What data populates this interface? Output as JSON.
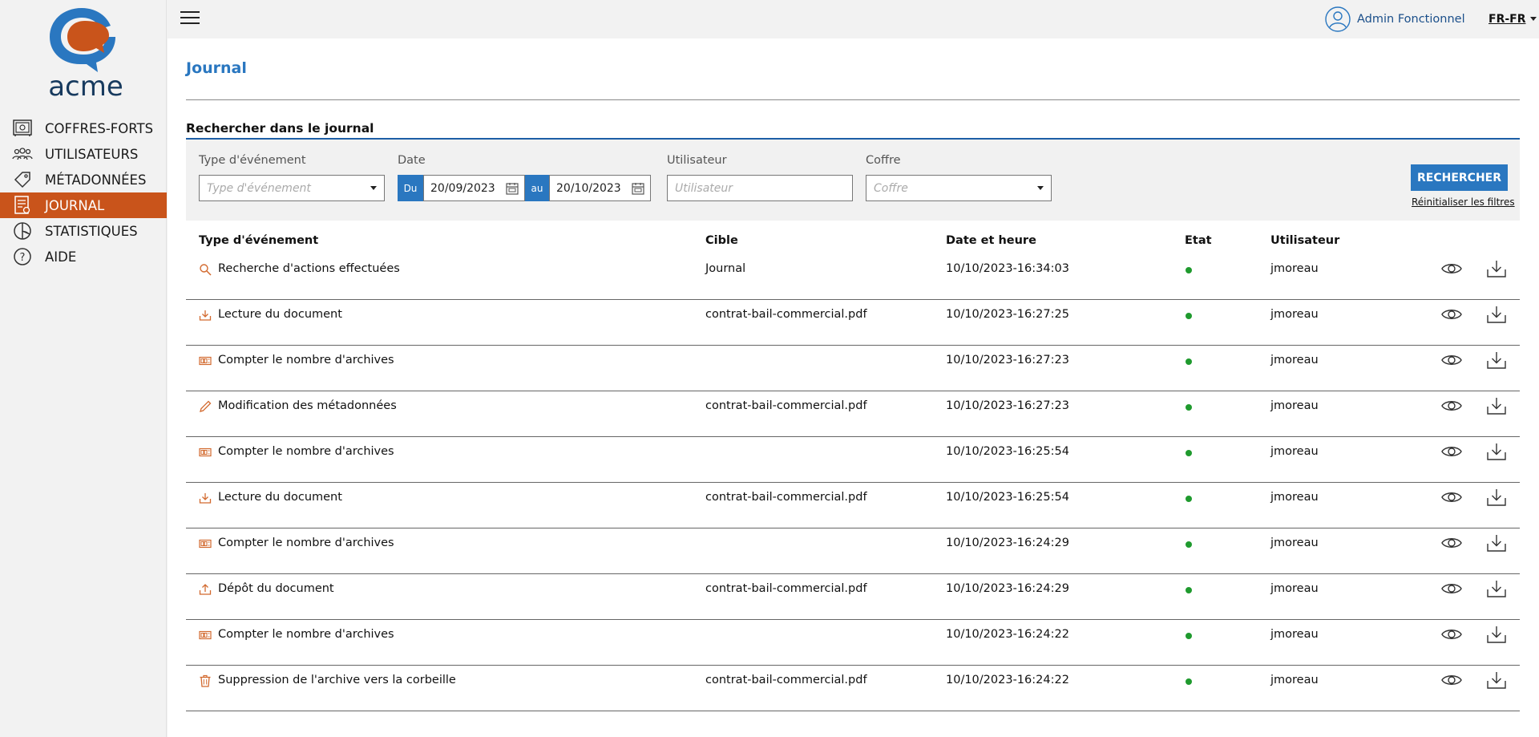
{
  "brand": {
    "logo_text": "acme",
    "accent": "#c9541b",
    "primary": "#2a77c0"
  },
  "sidebar": {
    "items": [
      {
        "label": "COFFRES-FORTS",
        "icon": "safe-icon"
      },
      {
        "label": "UTILISATEURS",
        "icon": "users-icon"
      },
      {
        "label": "MÉTADONNÉES",
        "icon": "tag-icon"
      },
      {
        "label": "JOURNAL",
        "icon": "journal-icon",
        "active": true
      },
      {
        "label": "STATISTIQUES",
        "icon": "pie-chart-icon"
      },
      {
        "label": "AIDE",
        "icon": "help-icon"
      }
    ]
  },
  "topbar": {
    "user_name": "Admin Fonctionnel",
    "language": "FR-FR"
  },
  "page": {
    "title": "Journal",
    "section_title": "Rechercher dans le journal"
  },
  "filters": {
    "event_type": {
      "label": "Type d'événement",
      "placeholder": "Type d'événement"
    },
    "date": {
      "label": "Date",
      "from_tag": "Du",
      "from_value": "20/09/2023",
      "to_tag": "au",
      "to_value": "20/10/2023"
    },
    "user": {
      "label": "Utilisateur",
      "placeholder": "Utilisateur"
    },
    "vault": {
      "label": "Coffre",
      "placeholder": "Coffre"
    },
    "search_button": "RECHERCHER",
    "reset_link": "Réinitialiser les filtres"
  },
  "table": {
    "columns": [
      "Type d'événement",
      "Cible",
      "Date et heure",
      "Etat",
      "Utilisateur"
    ],
    "rows": [
      {
        "icon": "search-icon",
        "event": "Recherche d'actions effectuées",
        "target": "Journal",
        "datetime": "10/10/2023-16:34:03",
        "status": "ok",
        "user": "jmoreau"
      },
      {
        "icon": "download-icon",
        "event": "Lecture du document",
        "target": "contrat-bail-commercial.pdf",
        "datetime": "10/10/2023-16:27:25",
        "status": "ok",
        "user": "jmoreau"
      },
      {
        "icon": "counter-icon",
        "event": "Compter le nombre d'archives",
        "target": "",
        "datetime": "10/10/2023-16:27:23",
        "status": "ok",
        "user": "jmoreau"
      },
      {
        "icon": "pencil-icon",
        "event": "Modification des métadonnées",
        "target": "contrat-bail-commercial.pdf",
        "datetime": "10/10/2023-16:27:23",
        "status": "ok",
        "user": "jmoreau"
      },
      {
        "icon": "counter-icon",
        "event": "Compter le nombre d'archives",
        "target": "",
        "datetime": "10/10/2023-16:25:54",
        "status": "ok",
        "user": "jmoreau"
      },
      {
        "icon": "download-icon",
        "event": "Lecture du document",
        "target": "contrat-bail-commercial.pdf",
        "datetime": "10/10/2023-16:25:54",
        "status": "ok",
        "user": "jmoreau"
      },
      {
        "icon": "counter-icon",
        "event": "Compter le nombre d'archives",
        "target": "",
        "datetime": "10/10/2023-16:24:29",
        "status": "ok",
        "user": "jmoreau"
      },
      {
        "icon": "upload-icon",
        "event": "Dépôt du document",
        "target": "contrat-bail-commercial.pdf",
        "datetime": "10/10/2023-16:24:29",
        "status": "ok",
        "user": "jmoreau"
      },
      {
        "icon": "counter-icon",
        "event": "Compter le nombre d'archives",
        "target": "",
        "datetime": "10/10/2023-16:24:22",
        "status": "ok",
        "user": "jmoreau"
      },
      {
        "icon": "trash-icon",
        "event": "Suppression de l'archive vers la corbeille",
        "target": "contrat-bail-commercial.pdf",
        "datetime": "10/10/2023-16:24:22",
        "status": "ok",
        "user": "jmoreau"
      }
    ]
  }
}
